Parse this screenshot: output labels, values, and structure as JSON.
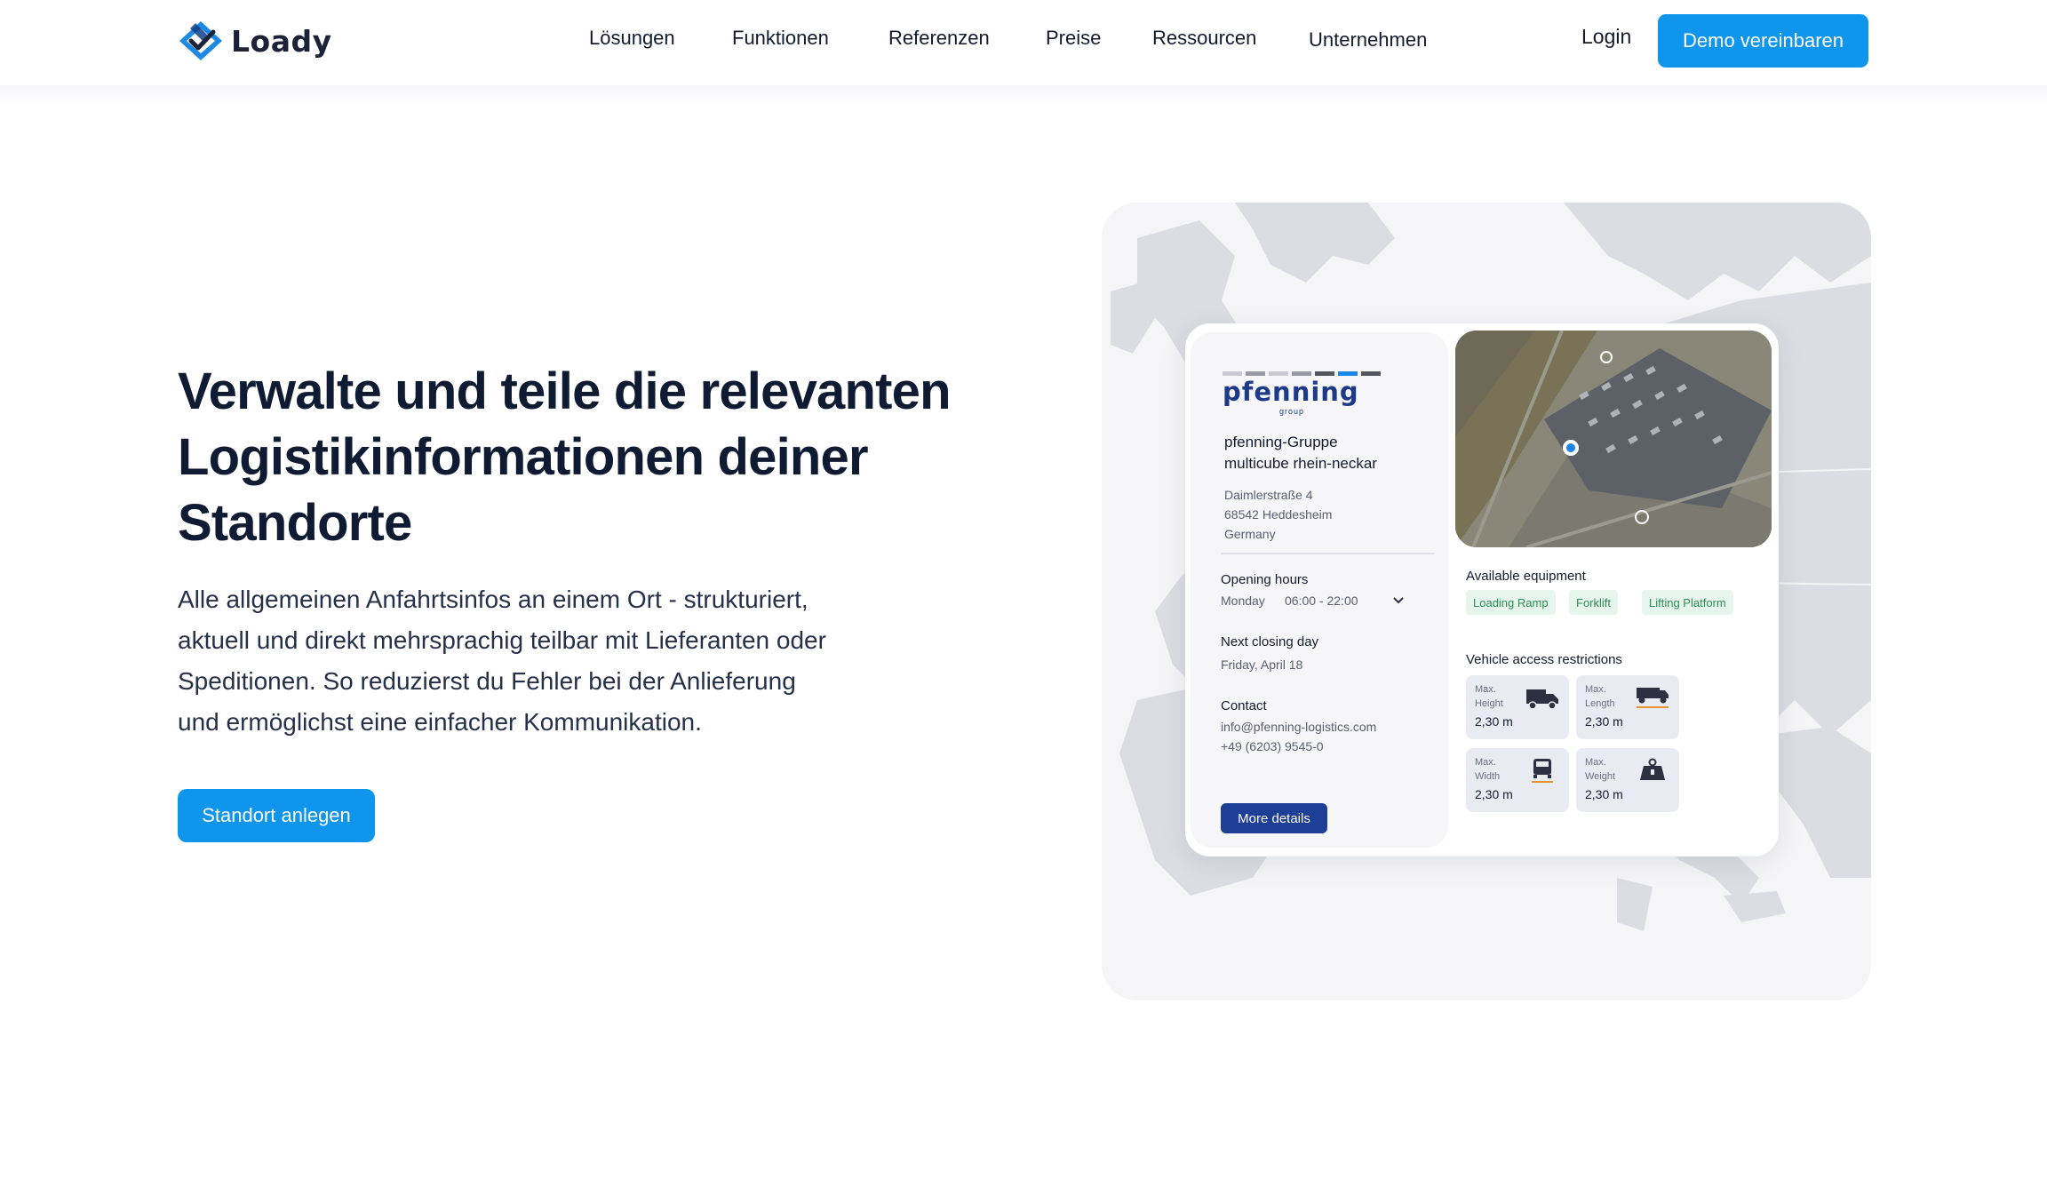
{
  "brand": {
    "name": "Loady"
  },
  "nav": {
    "items": [
      "Lösungen",
      "Funktionen",
      "Referenzen",
      "Preise",
      "Ressourcen",
      "Unternehmen"
    ],
    "login": "Login",
    "demo_button": "Demo vereinbaren"
  },
  "hero": {
    "title_lines": [
      "Verwalte und teile die relevanten",
      "Logistikinformationen deiner",
      "Standorte"
    ],
    "text_lines": [
      "Alle allgemeinen Anfahrtsinfos an einem Ort - strukturiert,",
      "aktuell und direkt mehrsprachig teilbar mit Lieferanten oder",
      "Speditionen. So reduzierst du Fehler bei der Anlieferung",
      "und ermöglichst eine einfacher Kommunikation."
    ],
    "cta": "Standort anlegen"
  },
  "location_card": {
    "company_logo": "pfenning",
    "company_logo_sub": "group",
    "name_lines": [
      "pfenning-Gruppe",
      "multicube rhein-neckar"
    ],
    "address_lines": [
      "Daimlerstraße 4",
      "68542 Heddesheim",
      "Germany"
    ],
    "opening_hours": {
      "title": "Opening hours",
      "day": "Monday",
      "time": "06:00 - 22:00",
      "icon": "chevron-down-icon"
    },
    "next_closing": {
      "title": "Next closing day",
      "value": "Friday, April 18"
    },
    "contact": {
      "title": "Contact",
      "email": "info@pfenning-logistics.com",
      "phone": "+49 (6203) 9545-0"
    },
    "more_button": "More details",
    "equipment": {
      "title": "Available equipment",
      "items": [
        "Loading Ramp",
        "Forklift",
        "Lifting Platform"
      ]
    },
    "restrictions": {
      "title": "Vehicle access restrictions",
      "tiles": [
        {
          "label1": "Max.",
          "label2": "Height",
          "value": "2,30 m",
          "icon": "truck-height-icon"
        },
        {
          "label1": "Max.",
          "label2": "Length",
          "value": "2,30 m",
          "icon": "truck-length-icon"
        },
        {
          "label1": "Max.",
          "label2": "Width",
          "value": "2,30 m",
          "icon": "truck-width-icon"
        },
        {
          "label1": "Max.",
          "label2": "Weight",
          "value": "2,30 m",
          "icon": "weight-icon"
        }
      ]
    }
  },
  "colors": {
    "primary": "#0f95ec",
    "navy": "#1d3f96",
    "text": "#0f1a33",
    "chip_bg": "#e6f6ec",
    "chip_text": "#2c8f55"
  }
}
